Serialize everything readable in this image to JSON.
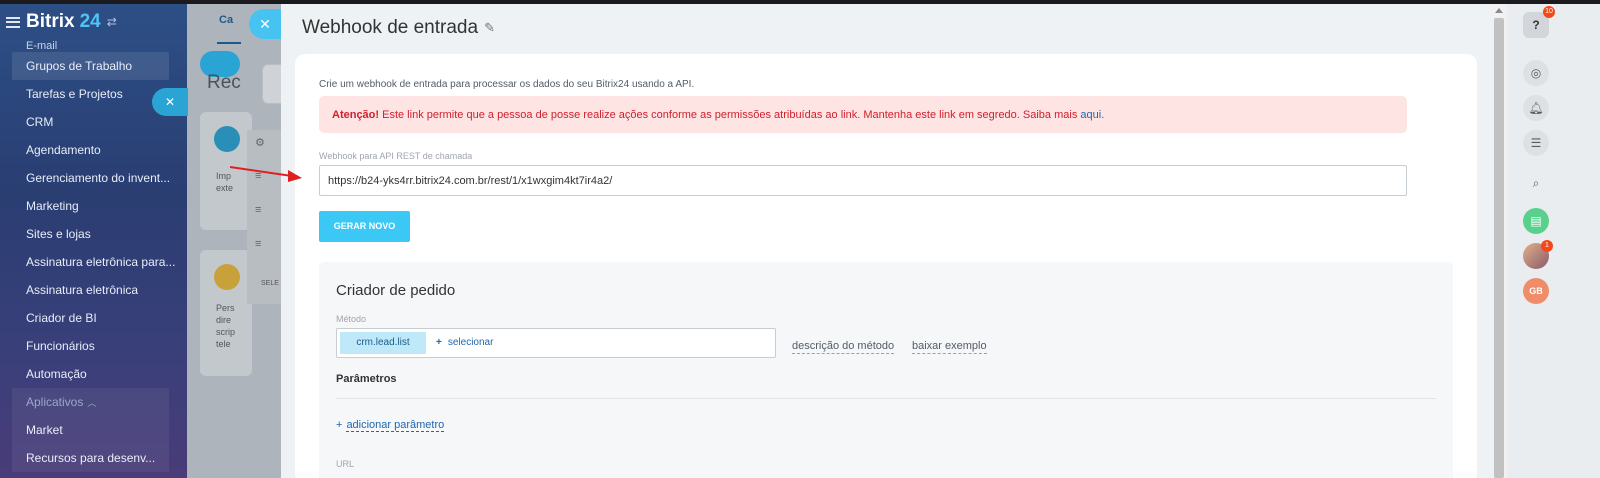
{
  "sidebar": {
    "brand": "Bitrix",
    "brand_num": "24",
    "items": [
      {
        "label": "E-mail"
      },
      {
        "label": "Grupos de Trabalho"
      },
      {
        "label": "Tarefas e Projetos"
      },
      {
        "label": "CRM"
      },
      {
        "label": "Agendamento"
      },
      {
        "label": "Gerenciamento do invent..."
      },
      {
        "label": "Marketing"
      },
      {
        "label": "Sites e lojas"
      },
      {
        "label": "Assinatura eletrônica para..."
      },
      {
        "label": "Assinatura eletrônica"
      },
      {
        "label": "Criador de BI"
      },
      {
        "label": "Funcionários"
      },
      {
        "label": "Automação"
      }
    ],
    "apps_group": {
      "label": "Aplicativos",
      "items": [
        {
          "label": "Market"
        },
        {
          "label": "Recursos para desenv..."
        }
      ]
    }
  },
  "background": {
    "tab_label": "Ca",
    "heading": "Rec",
    "card_text": [
      "Imp",
      "exte"
    ],
    "card2_text": [
      "Pers",
      "dire",
      "scrip",
      "tele"
    ],
    "row_label": "SELE"
  },
  "slider": {
    "title": "Webhook de entrada",
    "intro": "Crie um webhook de entrada para processar os dados do seu Bitrix24 usando a API.",
    "alert": {
      "strong": "Atenção!",
      "text": " Este link permite que a pessoa de posse realize ações conforme as permissões atribuídas ao link. Mantenha este link em segredo. Saiba mais ",
      "link": "aqui",
      "end": "."
    },
    "webhook_label": "Webhook para API REST de chamada",
    "webhook_url": "https://b24-yks4rr.bitrix24.com.br/rest/1/x1wxgim4kt7ir4a2/",
    "generate_button": "GERAR NOVO",
    "builder": {
      "title": "Criador de pedido",
      "method_label": "Método",
      "method_value": "crm.lead.list",
      "select_label": "selecionar",
      "method_description": "descrição do método",
      "download_example": "baixar exemplo",
      "params_title": "Parâmetros",
      "add_param": "adicionar parâmetro",
      "url_label": "URL"
    }
  },
  "rightbar": {
    "help_badge": "10",
    "avatar_badge": "1",
    "user_initials": "GB"
  },
  "colors": {
    "accent": "#3bc8f5",
    "alert_bg": "#ffe4e4",
    "alert_text": "#d0202c",
    "link": "#2067b0",
    "badge": "#f54819"
  }
}
